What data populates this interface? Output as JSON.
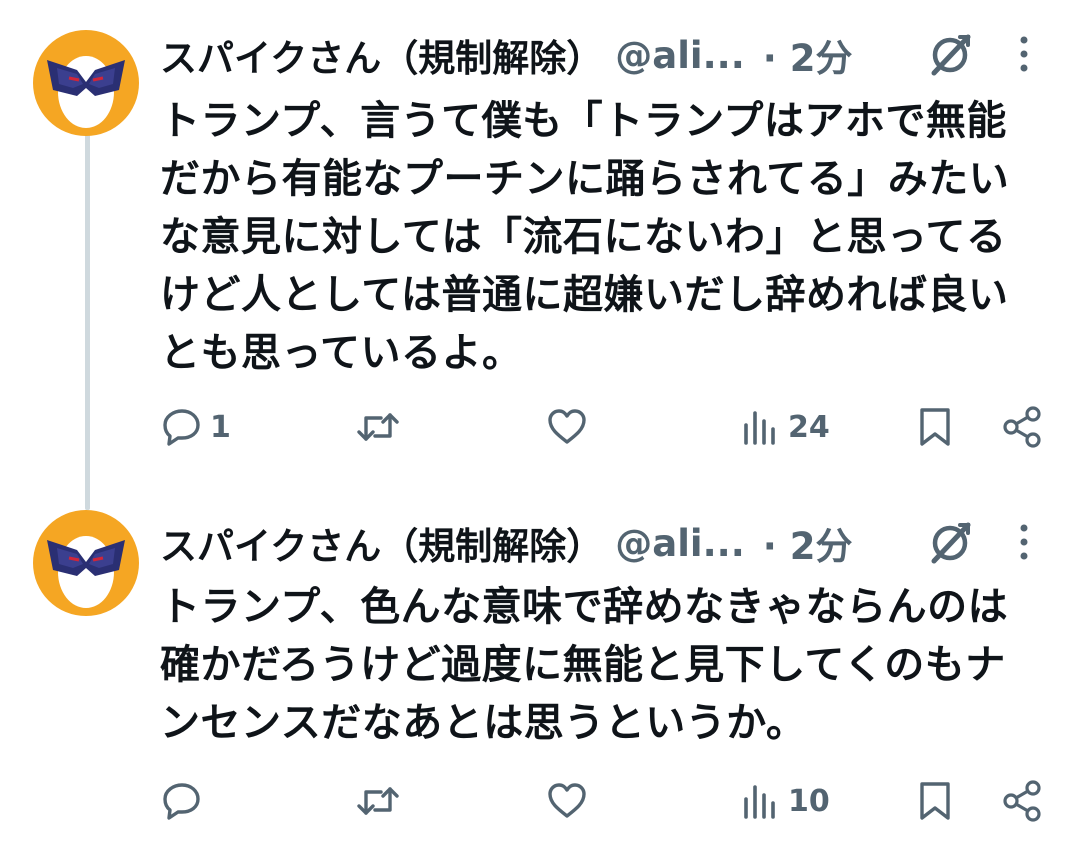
{
  "tweets": [
    {
      "display_name": "スパイクさん（規制解除）",
      "handle": "@ali...",
      "time": "· 2分",
      "text": "トランプ、言うて僕も「トランプはアホで無能だから有能なプーチンに踊らされてる」みたいな意見に対しては「流石にないわ」と思ってるけど人としては普通に超嫌いだし辞めれば良いとも思っているよ。",
      "reply_count": "1",
      "retweet_count": "",
      "like_count": "",
      "view_count": "24"
    },
    {
      "display_name": "スパイクさん（規制解除）",
      "handle": "@ali...",
      "time": "· 2分",
      "text": "トランプ、色んな意味で辞めなきゃならんのは確かだろうけど過度に無能と見下してくのもナンセンスだなあとは思うというか。",
      "reply_count": "",
      "retweet_count": "",
      "like_count": "",
      "view_count": "10"
    }
  ],
  "colors": {
    "text_primary": "#0f1419",
    "text_secondary": "#536471",
    "avatar_bg": "#f5a623",
    "thread_line": "#cfd9de"
  },
  "icons": {
    "reply": "reply-icon",
    "retweet": "retweet-icon",
    "like": "heart-icon",
    "views": "analytics-icon",
    "bookmark": "bookmark-icon",
    "share": "share-icon",
    "grok": "grok-icon",
    "more": "more-vertical-icon"
  }
}
